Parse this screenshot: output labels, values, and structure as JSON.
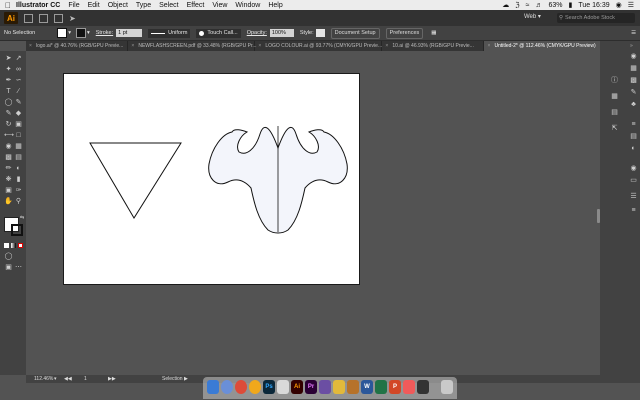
{
  "menubar": {
    "app_name": "Illustrator CC",
    "items": [
      "File",
      "Edit",
      "Object",
      "Type",
      "Select",
      "Effect",
      "View",
      "Window",
      "Help"
    ],
    "battery": "63%",
    "clock": "Tue 16:39"
  },
  "appbar": {
    "logo": "Ai",
    "workspace": "Web",
    "search_placeholder": "Search Adobe Stock"
  },
  "controlbar": {
    "selection": "No Selection",
    "stroke_label": "Stroke:",
    "stroke_weight": "1 pt",
    "profile": "Uniform",
    "brush": "Touch Call...",
    "opacity_label": "Opacity:",
    "opacity_value": "100%",
    "style_label": "Style:",
    "document_setup": "Document Setup",
    "preferences": "Preferences"
  },
  "tabs": [
    {
      "label": "logo.ai* @ 40.76% (RGB/GPU Previe...",
      "active": false
    },
    {
      "label": "NEWFLASHSCREEN.pdf @ 33.48% (RGB/GPU Pr...",
      "active": false
    },
    {
      "label": "LOGO COLOUR.ai @ 93.77% (CMYK/GPU Previe...",
      "active": false
    },
    {
      "label": "10.ai @ 46.93% (RGB/GPU Previe...",
      "active": false
    },
    {
      "label": "Untitled-2* @ 112.46% (CMYK/GPU Preview)",
      "active": true
    }
  ],
  "statusbar": {
    "zoom": "112.46%",
    "artboard": "1",
    "tool": "Selection"
  },
  "colors": {
    "ui_dark": "#323232",
    "ui_mid": "#424242",
    "pasteboard": "#535353",
    "artboard": "#ffffff",
    "accent": "#ff9a00"
  },
  "dock": {
    "labels": [
      "Ps",
      "Ai",
      "Pr",
      "W",
      "P"
    ]
  }
}
